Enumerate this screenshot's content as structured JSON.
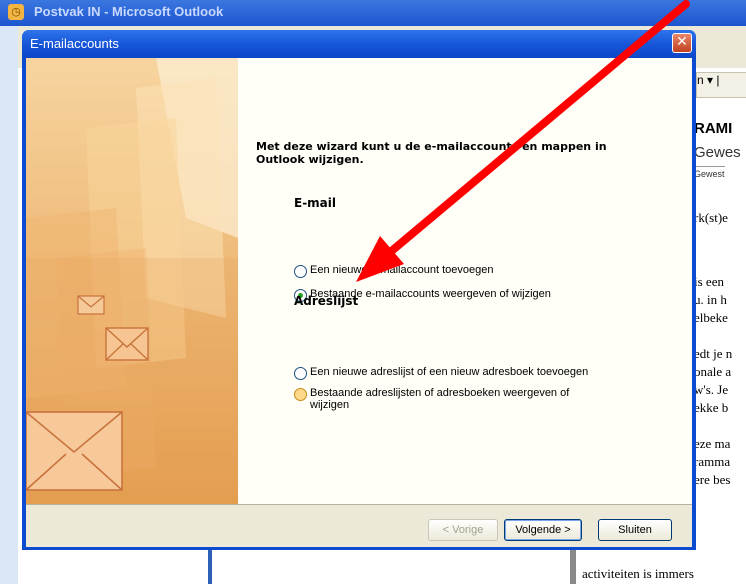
{
  "background_window": {
    "title": "Postvak IN - Microsoft Outlook",
    "toolbar_fragment": "n ▾ |",
    "reading_pane": {
      "heading": "RAMI",
      "subtitle": "Gewes",
      "subtitle_small": "Gewest",
      "lines": [
        "rk(st)e",
        "is een",
        "u. in h",
        "elbeke",
        "edt je n",
        "onale a",
        "w's. Je",
        "ekke b",
        "eze ma",
        "ramma",
        "ere bes"
      ],
      "bottom_line": "activiteiten is immers"
    }
  },
  "dialog": {
    "title": "E-mailaccounts",
    "close_glyph": "✕",
    "intro": "Met deze wizard kunt u de e-mailaccounts en mappen in Outlook wijzigen.",
    "email_section": {
      "title": "E-mail",
      "options": [
        {
          "label": "Een nieuwe e-mailaccount toevoegen",
          "selected": false
        },
        {
          "label": "Bestaande e-mailaccounts weergeven of wijzigen",
          "selected": true
        }
      ]
    },
    "address_section": {
      "title": "Adreslijst",
      "options": [
        {
          "label": "Een nieuwe adreslijst of een nieuw adresboek toevoegen",
          "selected": false
        },
        {
          "label": "Bestaande adreslijsten of adresboeken weergeven of wijzigen",
          "selected": false
        }
      ]
    },
    "buttons": {
      "back": "< Vorige",
      "next": "Volgende >",
      "close": "Sluiten"
    }
  },
  "colors": {
    "arrow": "#ff0000",
    "dialog_title": "#0a4bd0",
    "art_background": "#f3c889",
    "selected_radio": "#21a121"
  }
}
